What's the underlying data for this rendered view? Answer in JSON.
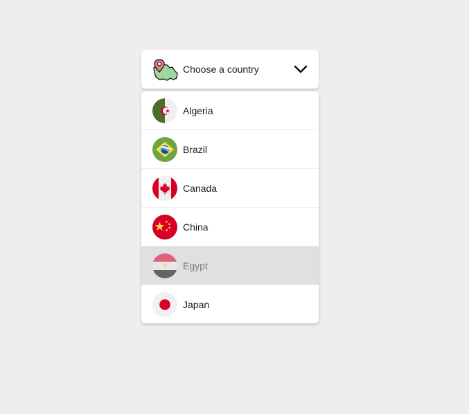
{
  "select": {
    "placeholder": "Choose a country",
    "icon": "map-pin-icon",
    "chevron": "chevron-down-icon"
  },
  "options": [
    {
      "label": "Algeria",
      "flag": "algeria-flag-icon"
    },
    {
      "label": "Brazil",
      "flag": "brazil-flag-icon"
    },
    {
      "label": "Canada",
      "flag": "canada-flag-icon"
    },
    {
      "label": "China",
      "flag": "china-flag-icon"
    },
    {
      "label": "Egypt",
      "flag": "egypt-flag-icon",
      "hovered": true
    },
    {
      "label": "Japan",
      "flag": "japan-flag-icon"
    }
  ],
  "colors": {
    "background": "#eeeeee",
    "panel": "#ffffff",
    "hover": "#e0e0e0"
  }
}
